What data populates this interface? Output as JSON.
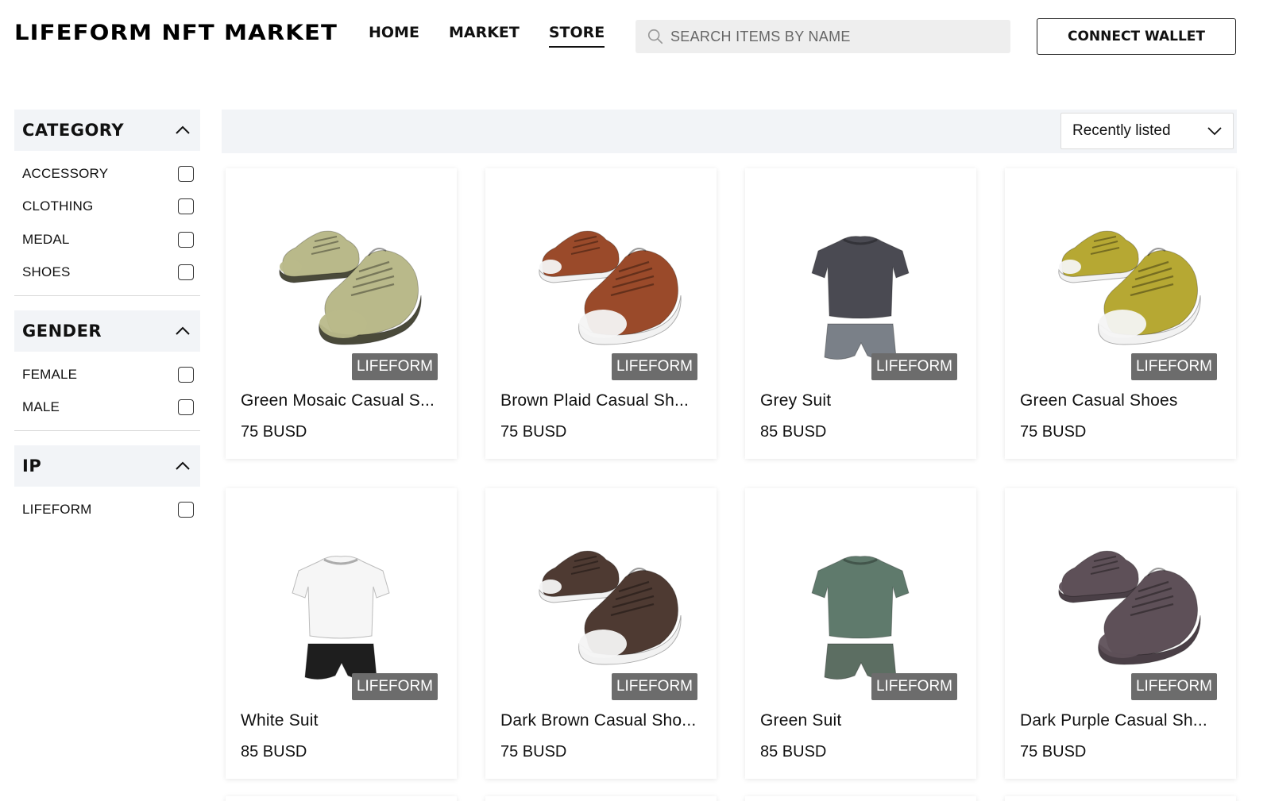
{
  "header": {
    "logo": "LIFEFORM NFT MARKET",
    "nav": [
      {
        "label": "HOME",
        "active": false
      },
      {
        "label": "MARKET",
        "active": false
      },
      {
        "label": "STORE",
        "active": true
      }
    ],
    "search_placeholder": "SEARCH ITEMS BY NAME",
    "search_icon": "search-icon",
    "wallet_label": "CONNECT WALLET"
  },
  "sidebar": {
    "groups": [
      {
        "title": "CATEGORY",
        "options": [
          "ACCESSORY",
          "CLOTHING",
          "MEDAL",
          "SHOES"
        ]
      },
      {
        "title": "GENDER",
        "options": [
          "FEMALE",
          "MALE"
        ]
      },
      {
        "title": "IP",
        "options": [
          "LIFEFORM"
        ]
      }
    ]
  },
  "toolbar": {
    "sort_label": "Recently listed"
  },
  "products": [
    {
      "name": "Green Mosaic Casual S...",
      "price": "75 BUSD",
      "badge": "LIFEFORM",
      "kind": "shoes",
      "color": "#b9b98a",
      "sole": "#4a4a3a",
      "toe": "#b9b98a"
    },
    {
      "name": "Brown Plaid Casual Sh...",
      "price": "75 BUSD",
      "badge": "LIFEFORM",
      "kind": "shoes",
      "color": "#9a4a2a",
      "sole": "#f2f2f2",
      "toe": "#f4f4f4"
    },
    {
      "name": "Grey Suit",
      "price": "85 BUSD",
      "badge": "LIFEFORM",
      "kind": "suit",
      "color": "#4a4a52",
      "bottom": "#7a8088"
    },
    {
      "name": "Green Casual Shoes",
      "price": "75 BUSD",
      "badge": "LIFEFORM",
      "kind": "shoes",
      "color": "#b6a833",
      "sole": "#f2f2f2",
      "toe": "#f4f4f4"
    },
    {
      "name": "White Suit",
      "price": "85 BUSD",
      "badge": "LIFEFORM",
      "kind": "suit",
      "color": "#f6f6f6",
      "bottom": "#1e1e1e"
    },
    {
      "name": "Dark Brown Casual Sho...",
      "price": "75 BUSD",
      "badge": "LIFEFORM",
      "kind": "shoes",
      "color": "#4e3a32",
      "sole": "#f2f2f2",
      "toe": "#f4f4f4"
    },
    {
      "name": "Green Suit",
      "price": "85 BUSD",
      "badge": "LIFEFORM",
      "kind": "suit",
      "color": "#5f7a6c",
      "bottom": "#5c6e62"
    },
    {
      "name": "Dark Purple Casual Sh...",
      "price": "75 BUSD",
      "badge": "LIFEFORM",
      "kind": "shoes",
      "color": "#5e5058",
      "sole": "#4a3f46",
      "toe": "#5e5058"
    }
  ]
}
